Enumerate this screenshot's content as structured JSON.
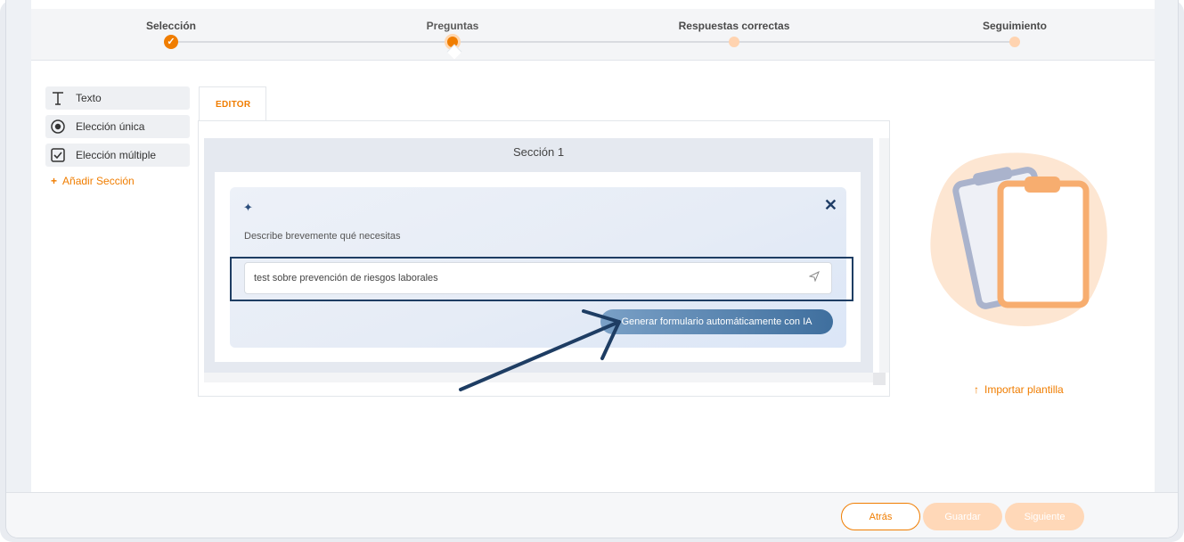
{
  "stepper": {
    "steps": [
      {
        "label": "Selección",
        "state": "done"
      },
      {
        "label": "Preguntas",
        "state": "current"
      },
      {
        "label": "Respuestas correctas",
        "state": "pending"
      },
      {
        "label": "Seguimiento",
        "state": "pending"
      }
    ],
    "done_mark": "✓"
  },
  "palette": {
    "items": [
      {
        "label": "Texto",
        "icon": "text-icon"
      },
      {
        "label": "Elección única",
        "icon": "radio-icon"
      },
      {
        "label": "Elección múltiple",
        "icon": "checkbox-icon"
      }
    ],
    "add_section": "Añadir Sección"
  },
  "editor": {
    "tab_label": "EDITOR",
    "section_title": "Sección 1",
    "ai_panel": {
      "describe_label": "Describe brevemente qué necesitas",
      "input_value": "test sobre prevención de riesgos laborales",
      "generate_button": "Generar formulario automáticamente con IA"
    }
  },
  "import_template": "Importar plantilla",
  "footer": {
    "back": "Atrás",
    "save": "Guardar",
    "next": "Siguiente"
  },
  "colors": {
    "accent": "#f07d00",
    "accent_light": "#ffd8b8",
    "navy": "#1e3d63"
  }
}
